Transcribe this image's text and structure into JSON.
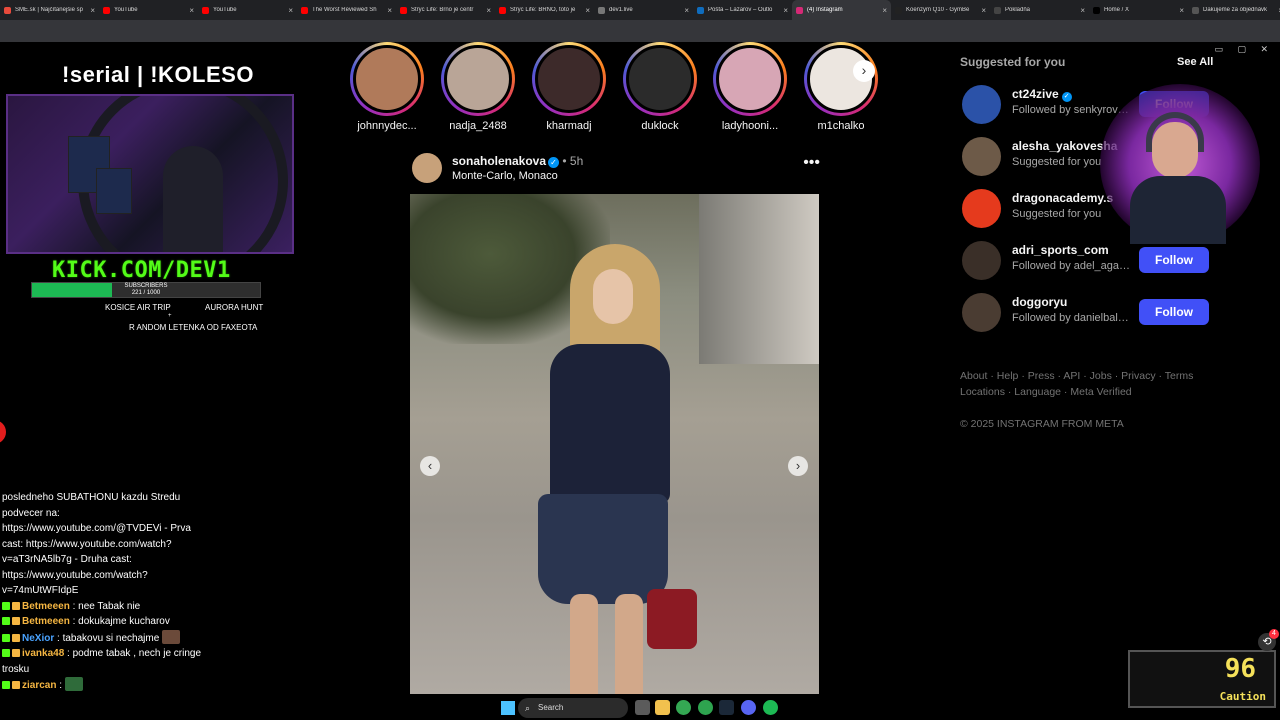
{
  "tabs": [
    {
      "title": "SME.sk | Najčítanejšie sp",
      "color": "#e94b3c"
    },
    {
      "title": "YouTube",
      "color": "#ff0000"
    },
    {
      "title": "YouTube",
      "color": "#ff0000"
    },
    {
      "title": "The Worst Reviewed Sh",
      "color": "#ff0000"
    },
    {
      "title": "Strýc Life: Brno je centr",
      "color": "#ff0000"
    },
    {
      "title": "Strýc Life: BRNO, toto je",
      "color": "#ff0000"
    },
    {
      "title": "dev1.live",
      "color": "#777777"
    },
    {
      "title": "Pošta – Lazarov – Outlo",
      "color": "#0f6cbd"
    },
    {
      "title": "(4) Instagram",
      "color": "#d62976",
      "active": true
    },
    {
      "title": "Koenzym Q10 - GymBe",
      "color": "#222222"
    },
    {
      "title": "Pokladňa",
      "color": "#444444"
    },
    {
      "title": "Home / X",
      "color": "#000000"
    },
    {
      "title": "Ďakujeme za objednávk",
      "color": "#555555"
    }
  ],
  "overlay": {
    "schedule_title": "!serial | !KOLESO",
    "kick_url": "KICK.COM/DEV1",
    "subscribers_label": "SUBSCRIBERS",
    "subscribers_count": "221 / 1000",
    "subscribers_fraction": 0.221,
    "goal_left": "KOSICE AIR TRIP",
    "goal_right": "AURORA HUNT",
    "goal_plus": "+",
    "goal_bottom": "R ANDOM LETENKA OD FAXEOTA"
  },
  "chat": {
    "intro": "posledneho SUBATHONU kazdu Stredu podvecer na: https://www.youtube.com/@TVDEVi - Prva cast: https://www.youtube.com/watch?v=aT3rNA5lb7g - Druha cast: https://www.youtube.com/watch?v=74mUtWFIdpE",
    "messages": [
      {
        "user": "Betmeeen",
        "color": "#f5b642",
        "text": ": nee Tabak nie"
      },
      {
        "user": "Betmeeen",
        "color": "#f5b642",
        "text": ": dokukajme kucharov"
      },
      {
        "user": "NeXior",
        "color": "#4aa3ff",
        "text": ": tabakovu si nechajme"
      },
      {
        "user": "ivanka48",
        "color": "#f5b642",
        "text": ": podme tabak , nech je cringe trosku"
      },
      {
        "user": "ziarcan",
        "color": "#f5b642",
        "text": ":"
      }
    ]
  },
  "stories": [
    {
      "name": "johnnydec...",
      "color": "#b07a5a"
    },
    {
      "name": "nadja_2488",
      "color": "#b9a597"
    },
    {
      "name": "kharmadj",
      "color": "#3d2a2a"
    },
    {
      "name": "duklock",
      "color": "#2b2b2b"
    },
    {
      "name": "ladyhooni...",
      "color": "#d7a6b5"
    },
    {
      "name": "m1chalko",
      "color": "#ece6e0"
    }
  ],
  "post": {
    "user": "sonaholenakova",
    "time": "5h",
    "location": "Monte-Carlo, Monaco",
    "more": "•••"
  },
  "suggestions": {
    "title": "Suggested for you",
    "see_all": "See All",
    "items": [
      {
        "name": "ct24zive",
        "verified": true,
        "sub": "Followed by senkyrova...",
        "button": "Follow",
        "avatar_color": "#2b52a8"
      },
      {
        "name": "alesha_yakovesha",
        "verified": false,
        "sub": "Suggested for you",
        "button": "",
        "avatar_color": "#6d5a48"
      },
      {
        "name": "dragonacademy.s",
        "verified": false,
        "sub": "Suggested for you",
        "button": "",
        "avatar_color": "#e53a1d"
      },
      {
        "name": "adri_sports_com",
        "verified": false,
        "sub": "Followed by adel_agapi...",
        "button": "Follow",
        "avatar_color": "#3a2f28"
      },
      {
        "name": "doggoryu",
        "verified": false,
        "sub": "Followed by danielbalo...",
        "button": "Follow",
        "avatar_color": "#4a3c32"
      }
    ],
    "footer_links": [
      "About",
      "Help",
      "Press",
      "API",
      "Jobs",
      "Privacy",
      "Terms",
      "Locations",
      "Language",
      "Meta Verified"
    ],
    "copyright": "© 2025 INSTAGRAM FROM META"
  },
  "counter": {
    "value": "96",
    "label": "Caution"
  },
  "notif_count": "4",
  "taskbar": {
    "search_placeholder": "Search"
  }
}
